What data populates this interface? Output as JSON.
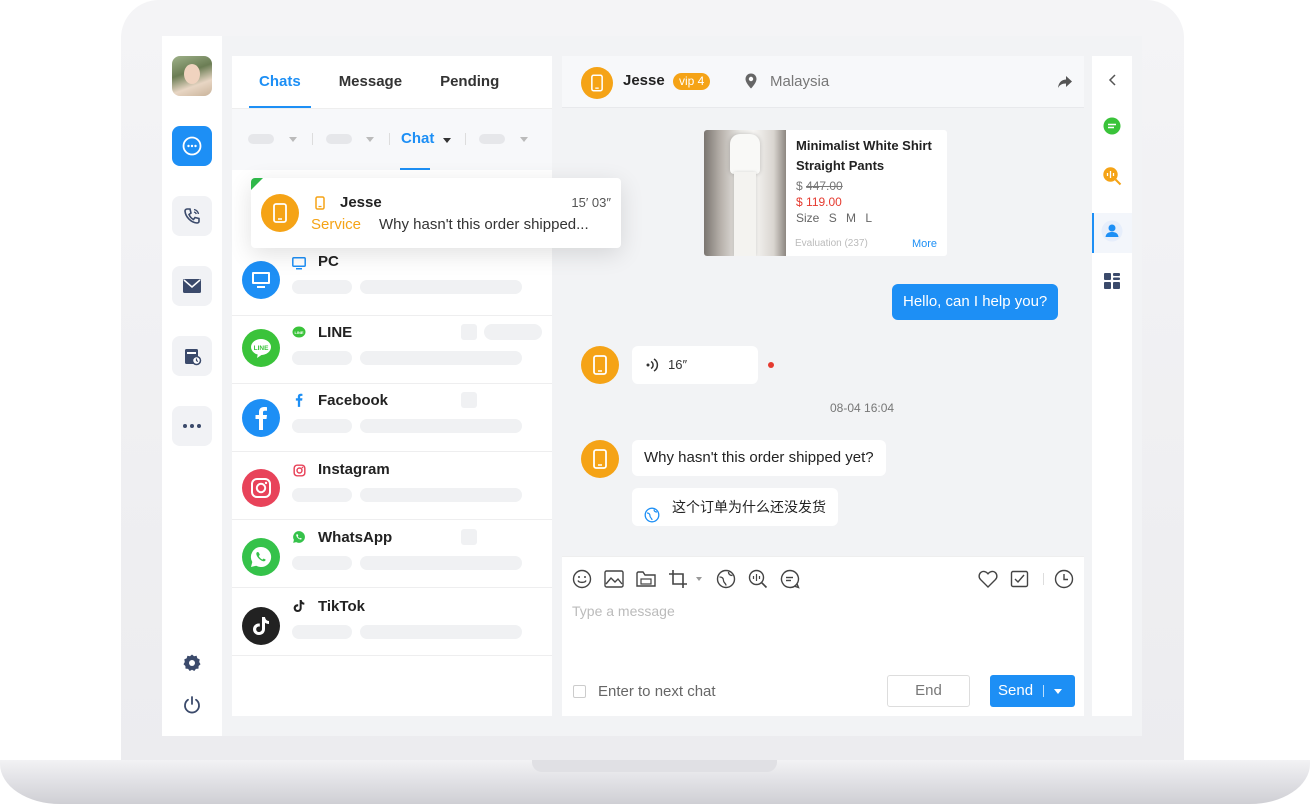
{
  "colors": {
    "accent": "#1d8ff5",
    "orange": "#f5a316",
    "line_green": "#3ac33a",
    "whatsapp_green": "#35c24a",
    "instagram_red": "#e8435a",
    "tiktok_black": "#222222",
    "price_red": "#e53a2f"
  },
  "rail": {
    "avatar": "user-avatar",
    "items": [
      {
        "icon": "chat-bubble-icon",
        "active": true
      },
      {
        "icon": "phone-icon",
        "active": false
      },
      {
        "icon": "mail-icon",
        "active": false
      },
      {
        "icon": "calendar-icon",
        "active": false
      },
      {
        "icon": "more-icon",
        "active": false
      }
    ],
    "bottom": [
      "settings-icon",
      "power-icon"
    ]
  },
  "list": {
    "tabs": [
      {
        "label": "Chats",
        "active": true
      },
      {
        "label": "Message",
        "active": false
      },
      {
        "label": "Pending",
        "active": false
      }
    ],
    "filter": {
      "selected": "Chat"
    },
    "active_chat": {
      "name": "Jesse",
      "time": "15′ 03″",
      "tag": "Service",
      "preview": "Why hasn't this order shipped..."
    },
    "channels": [
      {
        "name": "PC",
        "icon": "monitor-icon"
      },
      {
        "name": "LINE",
        "icon": "line-icon"
      },
      {
        "name": "Facebook",
        "icon": "facebook-icon"
      },
      {
        "name": "Instagram",
        "icon": "instagram-icon"
      },
      {
        "name": "WhatsApp",
        "icon": "whatsapp-icon"
      },
      {
        "name": "TikTok",
        "icon": "tiktok-icon"
      }
    ]
  },
  "conversation": {
    "header": {
      "name": "Jesse",
      "vip": "vip 4",
      "location": "Malaysia"
    },
    "product": {
      "title": "Minimalist White Shirt Straight Pants",
      "currency": "$",
      "old_price": "447.00",
      "new_price": "119.00",
      "size_label": "Size",
      "sizes": "S M L",
      "evaluation": "Evaluation (237)",
      "more": "More"
    },
    "outgoing": "Hello, can I help you?",
    "voice_duration": "16″",
    "timestamp": "08-04  16:04",
    "incoming": "Why hasn't this order shipped yet?",
    "translation": "这个订单为什么还没发货"
  },
  "composer": {
    "tools": [
      "emoji-icon",
      "image-icon",
      "folder-icon",
      "crop-icon",
      "translate-icon",
      "voice-search-icon",
      "quick-reply-icon"
    ],
    "right_tools": [
      "heart-icon",
      "edit-check-icon",
      "clock-icon"
    ],
    "placeholder": "Type a message",
    "checkbox_label": "Enter to next chat",
    "end_label": "End",
    "send_label": "Send"
  },
  "right_rail": [
    "collapse-icon",
    "chat-green-icon",
    "voice-search-orange-icon",
    "contact-icon",
    "apps-icon"
  ]
}
